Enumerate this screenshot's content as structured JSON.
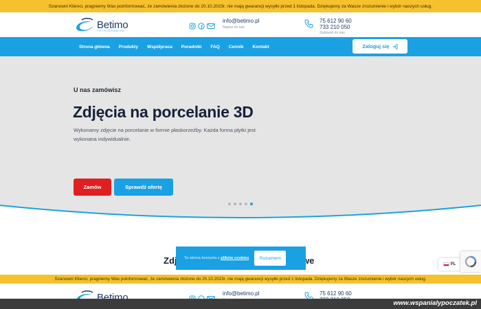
{
  "notice": "Szanowni Klienci, pragniemy Was poinformować, że zamówienia złożone do 20.10.2023r. nie mają gwarancji wysyłki przed 1 listopada. Dziękujemy za Wasze zrozumienie i wybór naszych usług.",
  "header": {
    "logo_text": "Betimo",
    "logo_sub": "FOTOCERAMIKA",
    "email": "info@betimo.pl",
    "email_sub": "Napisz do nas",
    "phone1": "75 612 90 60",
    "phone2": "733 210 050",
    "phone_sub": "Zadzwoń do nas",
    "social_icons": [
      "instagram-icon",
      "facebook-icon",
      "mail-icon"
    ]
  },
  "nav": {
    "items": [
      "Strona główna",
      "Produkty",
      "Współpraca",
      "Poradniki",
      "FAQ",
      "Cennik",
      "Kontakt"
    ],
    "login": "Zaloguj się"
  },
  "hero": {
    "eyebrow": "U nas zamówisz",
    "title": "Zdjęcia na porcelanie 3D",
    "description": "Wykonamy zdjęcie na porcelanie w formie płaskorzeźby. Każda forma płytki jest wykonana indywidualnie.",
    "btn_order": "Zamów",
    "btn_offer": "Sprawdź ofertę",
    "slides": 5,
    "active_slide": 5
  },
  "section": {
    "title_start": "Zdj",
    "title_end": "we"
  },
  "cookie": {
    "text": "Ta strona korzysta z",
    "link": "plików cookies",
    "button": "Rozumiem"
  },
  "lang": "PL",
  "watermark": "www.wspanialypoczatek.pl",
  "colors": {
    "accent": "#1aa1e3",
    "notice_bg": "#f6c12c",
    "order_btn": "#e02020",
    "hero_bg": "#e5e5e5"
  }
}
